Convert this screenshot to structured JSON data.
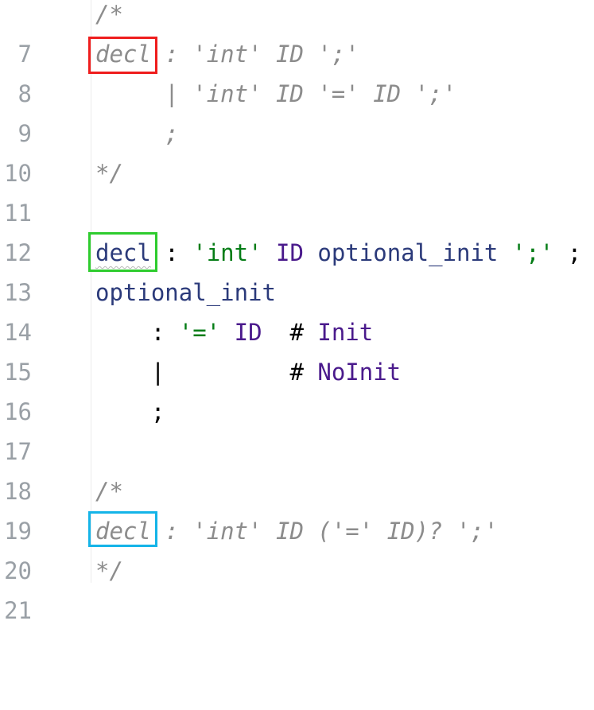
{
  "colors": {
    "box_red": "#ef1d1d",
    "box_green": "#2ecc2e",
    "box_blue": "#14b4e8"
  },
  "lines": [
    {
      "num": "7",
      "segments": [
        {
          "t": "/*"
        }
      ]
    },
    {
      "num": "8",
      "segments": [
        {
          "t": "decl"
        },
        {
          "t": " : 'int' ID ';'"
        }
      ]
    },
    {
      "num": "9",
      "segments": [
        {
          "t": "     | 'int' ID '=' ID ';'"
        }
      ]
    },
    {
      "num": "10",
      "segments": [
        {
          "t": "     ;"
        }
      ]
    },
    {
      "num": "11",
      "segments": [
        {
          "t": "*/"
        }
      ]
    },
    {
      "num": "12",
      "segments": []
    },
    {
      "num": "13",
      "segments": [
        {
          "t": "decl"
        },
        {
          "t": " : "
        },
        {
          "t": "'int'"
        },
        {
          "t": " ID "
        },
        {
          "t": "optional_init"
        },
        {
          "t": " "
        },
        {
          "t": "';'"
        },
        {
          "t": " ;"
        }
      ]
    },
    {
      "num": "14",
      "segments": [
        {
          "t": "optional_init"
        }
      ]
    },
    {
      "num": "15",
      "segments": [
        {
          "t": "    : "
        },
        {
          "t": "'='"
        },
        {
          "t": " ID"
        },
        {
          "t": "  # "
        },
        {
          "t": "Init"
        }
      ]
    },
    {
      "num": "16",
      "segments": [
        {
          "t": "    |"
        },
        {
          "t": "         # "
        },
        {
          "t": "NoInit"
        }
      ]
    },
    {
      "num": "17",
      "segments": [
        {
          "t": "    ;"
        }
      ]
    },
    {
      "num": "18",
      "segments": []
    },
    {
      "num": "19",
      "segments": [
        {
          "t": "/*"
        }
      ]
    },
    {
      "num": "20",
      "segments": [
        {
          "t": "decl"
        },
        {
          "t": " : 'int' ID ('=' ID)? ';'"
        }
      ]
    },
    {
      "num": "21",
      "segments": [
        {
          "t": "*/"
        }
      ]
    }
  ]
}
